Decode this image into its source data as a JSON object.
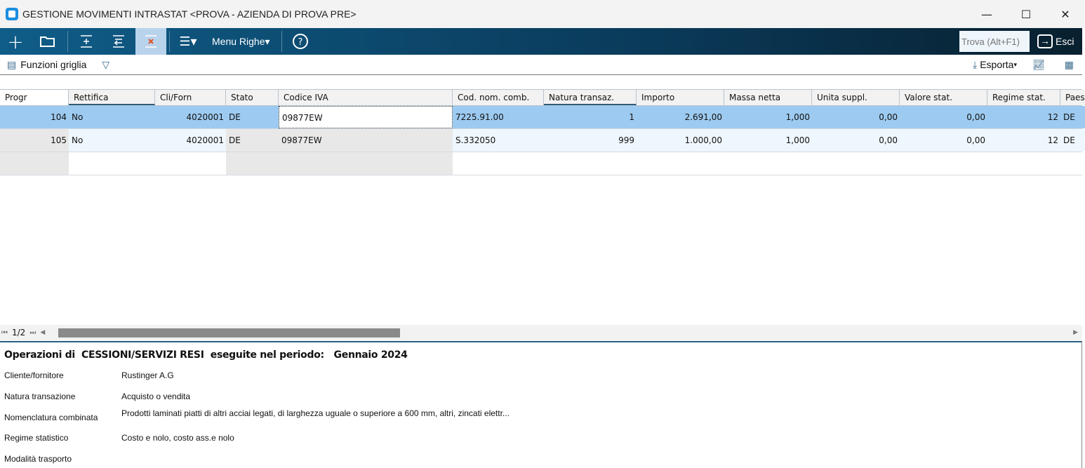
{
  "window": {
    "title": "GESTIONE MOVIMENTI INTRASTAT <PROVA - AZIENDA DI PROVA PRE>",
    "minimize": "—",
    "maximize": "☐",
    "close": "✕"
  },
  "toolbar": {
    "menu_righe": "Menu Righe",
    "find_placeholder": "Trova (Alt+F1)",
    "exit": "Esci"
  },
  "subbar": {
    "grid_functions": "Funzioni griglia",
    "export": "Esporta"
  },
  "grid": {
    "columns": [
      "Progr",
      "Rettifica",
      "Cli/Forn",
      "Stato",
      "Codice IVA",
      "Cod. nom. comb.",
      "Natura transaz.",
      "Importo",
      "Massa netta",
      "Unita suppl.",
      "Valore stat.",
      "Regime stat.",
      "Paes"
    ],
    "rows": [
      [
        "104",
        "No",
        "4020001",
        "DE",
        "09877EW",
        "7225.91.00",
        "1",
        "2.691,00",
        "1,000",
        "0,00",
        "0,00",
        "12",
        "DE"
      ],
      [
        "105",
        "No",
        "4020001",
        "DE",
        "09877EW",
        "S.332050",
        "999",
        "1.000,00",
        "1,000",
        "0,00",
        "0,00",
        "12",
        "DE"
      ]
    ]
  },
  "pager": {
    "page": "1/2"
  },
  "detail": {
    "heading": "Operazioni di  CESSIONI/SERVIZI RESI  eseguite nel periodo:   Gennaio 2024",
    "fields": [
      {
        "label": "Cliente/fornitore",
        "value": "Rustinger A.G"
      },
      {
        "label": "Natura transazione",
        "value": "Acquisto o vendita"
      },
      {
        "label": "Nomenclatura combinata",
        "value": "Prodotti laminati piatti di altri acciai legati, di larghezza uguale o superiore a 600 mm, altri, zincati elettr..."
      },
      {
        "label": "Regime statistico",
        "value": "Costo e nolo, costo ass.e nolo"
      },
      {
        "label": "Modalità trasporto",
        "value": ""
      }
    ]
  }
}
